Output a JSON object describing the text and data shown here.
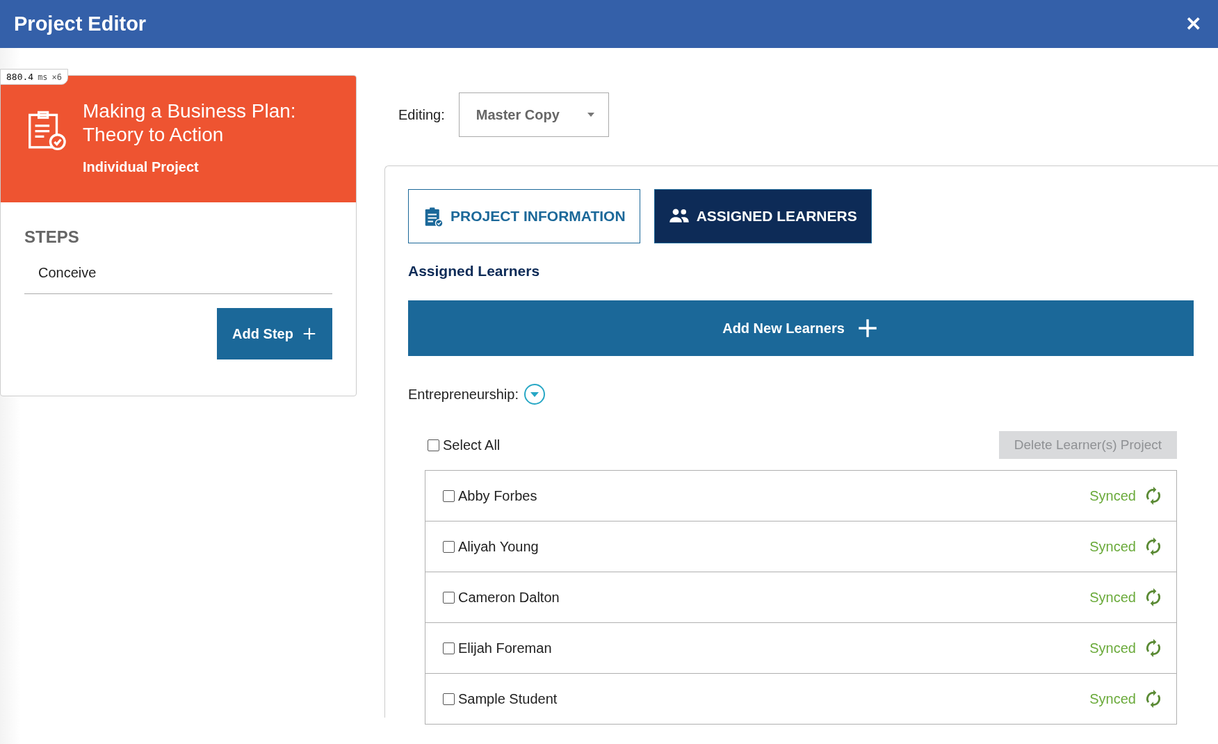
{
  "window": {
    "title": "Project Editor",
    "close": "✕"
  },
  "perf_badge": {
    "value": "880.4",
    "unit": "ms",
    "count": "×6"
  },
  "project": {
    "title": "Making a Business Plan: Theory to Action",
    "type": "Individual Project"
  },
  "steps": {
    "heading": "STEPS",
    "items": [
      "Conceive"
    ],
    "add_button": "Add Step"
  },
  "editing": {
    "label": "Editing:",
    "value": "Master Copy"
  },
  "tabs": [
    {
      "label": "PROJECT INFORMATION",
      "selected": false
    },
    {
      "label": "ASSIGNED LEARNERS",
      "selected": true
    }
  ],
  "section_title": "Assigned Learners",
  "add_learners_button": "Add New Learners",
  "group": {
    "label": "Entrepreneurship:",
    "expanded": false
  },
  "select_all": {
    "label": "Select All",
    "checked": false
  },
  "delete_button": {
    "label": "Delete Learner(s) Project",
    "disabled": true
  },
  "learners": [
    {
      "name": "Abby Forbes",
      "checked": false,
      "status": "Synced"
    },
    {
      "name": "Aliyah Young",
      "checked": false,
      "status": "Synced"
    },
    {
      "name": "Cameron Dalton",
      "checked": false,
      "status": "Synced"
    },
    {
      "name": "Elijah Foreman",
      "checked": false,
      "status": "Synced"
    },
    {
      "name": "Sample Student",
      "checked": false,
      "status": "Synced"
    }
  ]
}
